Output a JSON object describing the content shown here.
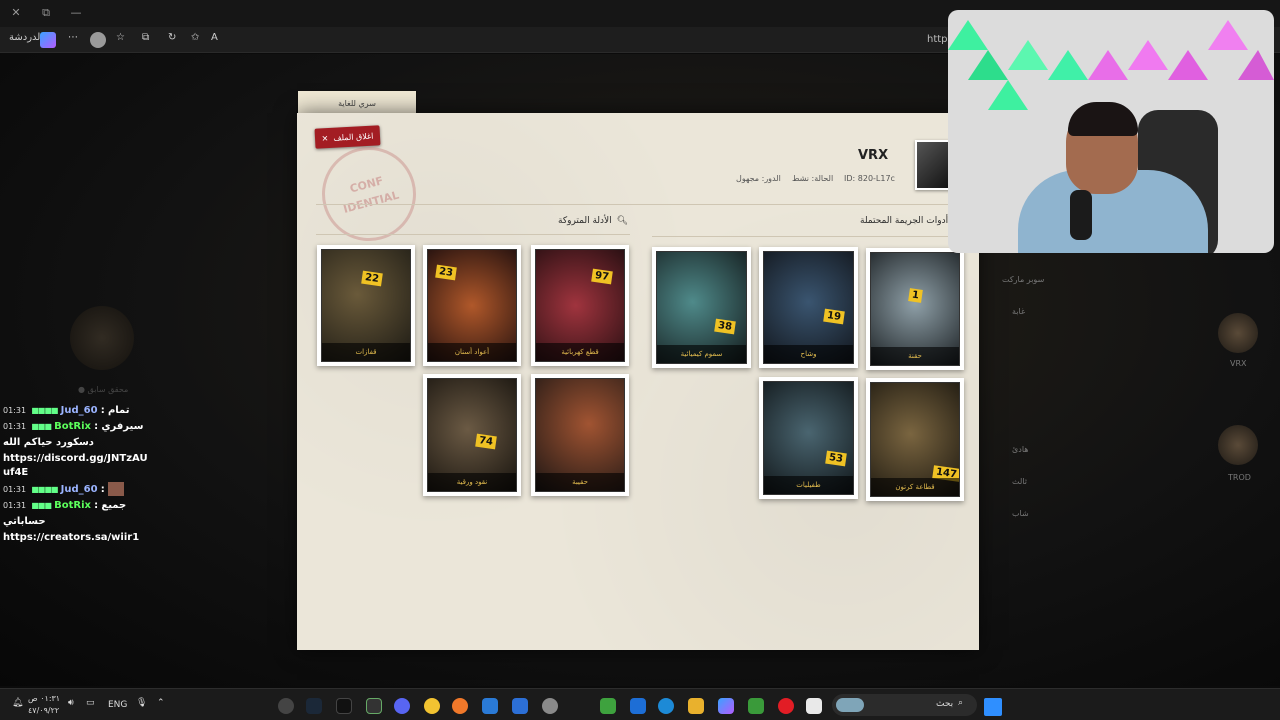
{
  "browser": {
    "sidebar_label": "الدردشة",
    "address": "https:",
    "window_buttons": [
      "✕",
      "⧉",
      "—"
    ]
  },
  "dossier": {
    "tab_label": "سري للغاية",
    "close_label": "اغلاق الملف",
    "stamp_text": "CONF IDENTIAL",
    "profile": {
      "name": "VRX",
      "id": "ID: 820-L17c",
      "status": "الحالة: نشط",
      "role": "الدور: مجهول"
    },
    "left_section_title": "الأدلة المتروكة",
    "right_section_title": "أدوات الجريمة المحتملة",
    "left_cards": [
      {
        "label": "قفازات",
        "tag": "22"
      },
      {
        "label": "أعواد أسنان",
        "tag": "23"
      },
      {
        "label": "قطع كهربائية",
        "tag": "97"
      },
      {
        "label": "نقود ورقية",
        "tag": "74"
      },
      {
        "label": "حقيبة",
        "tag": ""
      }
    ],
    "right_cards": [
      {
        "label": "سموم كيميائية",
        "tag": "38"
      },
      {
        "label": "وشاح",
        "tag": "19"
      },
      {
        "label": "حقنة",
        "tag": "1"
      },
      {
        "label": "طفيليات",
        "tag": "53"
      },
      {
        "label": "قطاعة كرتون",
        "tag": "147"
      }
    ]
  },
  "game_sidebar": {
    "items": [
      "سوبر ماركت",
      "غابة",
      "هادئ",
      "ثالث",
      "شاب"
    ],
    "players": [
      "VRX",
      "TROD"
    ],
    "left_caption": "● محقق سابق"
  },
  "chat": {
    "messages": [
      {
        "time": "01:31",
        "user": "Jud_60",
        "sep": ":",
        "text": "تمام"
      },
      {
        "time": "01:31",
        "user": "BotRix",
        "sep": ":",
        "text": "سيرفري"
      },
      {
        "time": "",
        "user": "",
        "sep": "",
        "text": "دسكورد حياكم الله"
      },
      {
        "time": "",
        "user": "",
        "sep": "",
        "text": "https://discord.gg/JNTzAUuf4E"
      },
      {
        "time": "01:31",
        "user": "Jud_60",
        "sep": ":",
        "text": ""
      },
      {
        "time": "01:31",
        "user": "BotRix",
        "sep": ":",
        "text": "جميع"
      },
      {
        "time": "",
        "user": "",
        "sep": "",
        "text": "حساباتي"
      },
      {
        "time": "",
        "user": "",
        "sep": "",
        "text": "https://creators.sa/wiir1"
      }
    ]
  },
  "taskbar": {
    "search_placeholder": "بحث",
    "lang": "ENG",
    "time": "٠١:٣١ ص",
    "date": "٤٧/٠٩/٢٢"
  },
  "colors": {
    "accent_red": "#a31d23",
    "tag_yellow": "#f0c224",
    "paper": "#ebe6d9"
  }
}
